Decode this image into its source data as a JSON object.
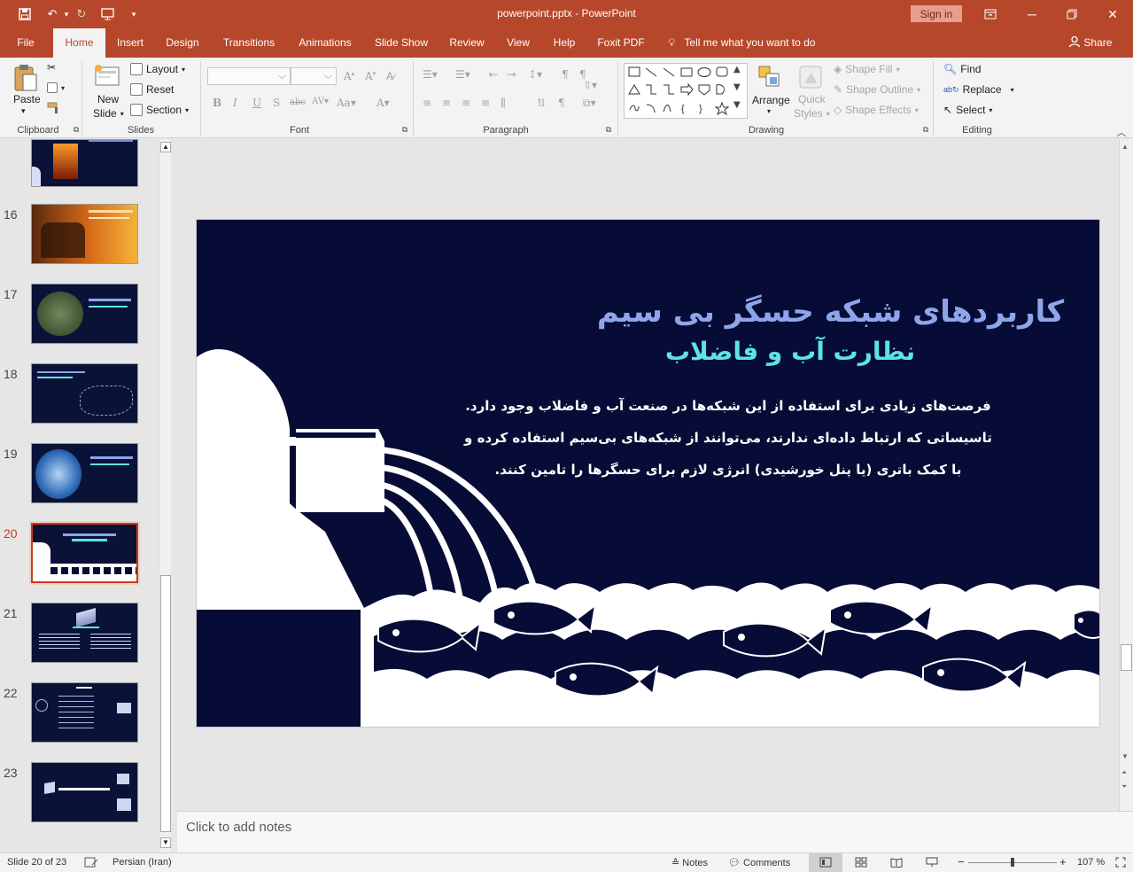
{
  "window": {
    "title": "powerpoint.pptx  -  PowerPoint",
    "sign_in": "Sign in",
    "colors": {
      "brand": "#b7472a",
      "slide_bg": "#060c35",
      "title_color": "#8ea5ea",
      "subtitle_color": "#5de3e8"
    }
  },
  "tabs": [
    "File",
    "Home",
    "Insert",
    "Design",
    "Transitions",
    "Animations",
    "Slide Show",
    "Review",
    "View",
    "Help",
    "Foxit PDF"
  ],
  "tell_me": "Tell me what you want to do",
  "share": "Share",
  "ribbon": {
    "clipboard": {
      "paste": "Paste",
      "label": "Clipboard"
    },
    "slides": {
      "new_slide_line1": "New",
      "new_slide_line2": "Slide",
      "layout": "Layout",
      "reset": "Reset",
      "section": "Section",
      "label": "Slides"
    },
    "font": {
      "label": "Font"
    },
    "paragraph": {
      "label": "Paragraph"
    },
    "drawing": {
      "arrange": "Arrange",
      "quick_styles_line1": "Quick",
      "quick_styles_line2": "Styles",
      "shape_fill": "Shape Fill",
      "shape_outline": "Shape Outline",
      "shape_effects": "Shape Effects",
      "label": "Drawing"
    },
    "editing": {
      "find": "Find",
      "replace": "Replace",
      "select": "Select",
      "label": "Editing"
    }
  },
  "thumbnails": [
    {
      "num": "16",
      "theme": "fire-photo"
    },
    {
      "num": "17",
      "theme": "dark-earth"
    },
    {
      "num": "18",
      "theme": "dark-map"
    },
    {
      "num": "19",
      "theme": "dark-globe"
    },
    {
      "num": "20",
      "theme": "dark-water",
      "selected": true
    },
    {
      "num": "21",
      "theme": "dark-layers"
    },
    {
      "num": "22",
      "theme": "dark-list"
    },
    {
      "num": "23",
      "theme": "dark-thanks"
    }
  ],
  "slide": {
    "title": "کاربردهای شبکه حسگر بی سیم",
    "subtitle": "نظارت آب و فاضلاب",
    "body_lines": [
      "فرصت‌های زیادی برای استفاده از این شبکه‌ها در صنعت آب و فاضلاب وجود دارد.",
      "تاسیساتی که ارتباط داده‌ای ندارند، می‌توانند از شبکه‌های بی‌سیم استفاده کرده و",
      "با کمک باتری (یا پنل خورشیدی) انرژی لازم برای حسگرها را تامین کنند."
    ]
  },
  "notes_placeholder": "Click to add notes",
  "status": {
    "slide_info": "Slide 20 of 23",
    "language": "Persian (Iran)",
    "notes": "Notes",
    "comments": "Comments",
    "zoom": "107 %",
    "zoom_fraction": 0.5
  }
}
